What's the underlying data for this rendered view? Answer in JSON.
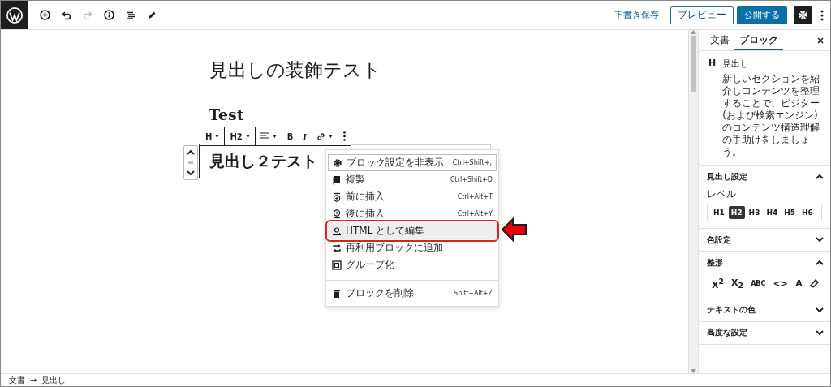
{
  "topbar": {
    "save_draft": "下書き保存",
    "preview": "プレビュー",
    "publish": "公開する"
  },
  "editor": {
    "title": "見出しの装飾テスト",
    "paragraph": "Test",
    "heading": "見出し２テスト"
  },
  "block_toolbar": {
    "items": [
      {
        "kind": "text",
        "label": "H",
        "dropdown": true
      },
      {
        "kind": "text",
        "label": "H2",
        "dropdown": true
      },
      {
        "kind": "align",
        "dropdown": true
      },
      {
        "kind": "bold",
        "label": "B"
      },
      {
        "kind": "italic",
        "label": "I"
      },
      {
        "kind": "link",
        "dropdown": true
      },
      {
        "kind": "more"
      }
    ]
  },
  "menu": {
    "sections": [
      {
        "items": [
          {
            "label": "ブロック設定を非表示",
            "shortcut": "Ctrl+Shift+,",
            "focused": true,
            "annotated": false
          },
          {
            "label": "複製",
            "shortcut": "Ctrl+Shift+D",
            "focused": false,
            "annotated": false
          },
          {
            "label": "前に挿入",
            "shortcut": "Ctrl+Alt+T",
            "focused": false,
            "annotated": false
          },
          {
            "label": "後に挿入",
            "shortcut": "Ctrl+Alt+Y",
            "focused": false,
            "annotated": false
          },
          {
            "label": "HTML として編集",
            "focused": false,
            "annotated": true
          },
          {
            "label": "再利用ブロックに追加",
            "focused": false,
            "annotated": false
          },
          {
            "label": "グループ化",
            "focused": false,
            "annotated": false
          }
        ]
      },
      {
        "items": [
          {
            "label": "ブロックを削除",
            "shortcut": "Shift+Alt+Z",
            "focused": false,
            "annotated": false
          }
        ]
      }
    ]
  },
  "sidebar": {
    "tabs": [
      {
        "label": "文書",
        "selected": false
      },
      {
        "label": "ブロック",
        "selected": true
      }
    ],
    "block": {
      "icon": "H",
      "name": "見出し",
      "description": "新しいセクションを紹介しコンテンツを整理することで、ビジター (および検索エンジン) のコンテンツ構造理解の手助けをしましょう。"
    },
    "panels": [
      {
        "kind": "levels",
        "title": "見出し設定",
        "expanded": true,
        "label": "レベル",
        "levels": [
          {
            "label": "H1",
            "selected": false
          },
          {
            "label": "H2",
            "selected": true
          },
          {
            "label": "H3",
            "selected": false
          },
          {
            "label": "H4",
            "selected": false
          },
          {
            "label": "H5",
            "selected": false
          },
          {
            "label": "H6",
            "selected": false
          }
        ]
      },
      {
        "title": "色設定",
        "expanded": false
      },
      {
        "kind": "format",
        "title": "整形",
        "expanded": true,
        "buttons": [
          "X$^{2}$",
          "X$_{2}$",
          "ABC",
          "<>",
          "A"
        ]
      },
      {
        "title": "テキストの色",
        "expanded": false
      },
      {
        "title": "高度な設定",
        "expanded": false
      }
    ]
  },
  "status_bar": {
    "breadcrumb": [
      "文書",
      "見出し"
    ],
    "separator": "→"
  }
}
